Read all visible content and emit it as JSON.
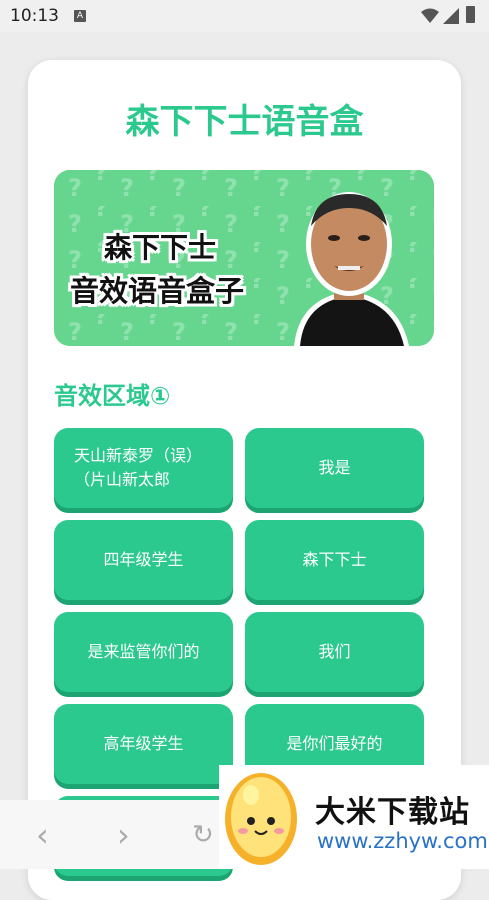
{
  "status_bar": {
    "time": "10:13",
    "notif_letter": "A"
  },
  "app": {
    "title": "森下下士语音盒"
  },
  "banner": {
    "line1": "森下下士",
    "line2": "音效语音盒子"
  },
  "section": {
    "title": "音效区域①"
  },
  "buttons": [
    {
      "label": "天山新泰罗（误）\n（片山新太郎"
    },
    {
      "label": "我是"
    },
    {
      "label": "四年级学生"
    },
    {
      "label": "森下下士"
    },
    {
      "label": "是来监管你们的"
    },
    {
      "label": "我们"
    },
    {
      "label": "高年级学生"
    },
    {
      "label": "是你们最好的"
    }
  ],
  "nav": {
    "back": "‹",
    "forward": "›",
    "reload": "↻"
  },
  "ad": {
    "name": "大米下载站",
    "url": "www.zzhyw.com"
  },
  "colors": {
    "accent": "#2cc98f",
    "accent_dark": "#1ca572"
  }
}
